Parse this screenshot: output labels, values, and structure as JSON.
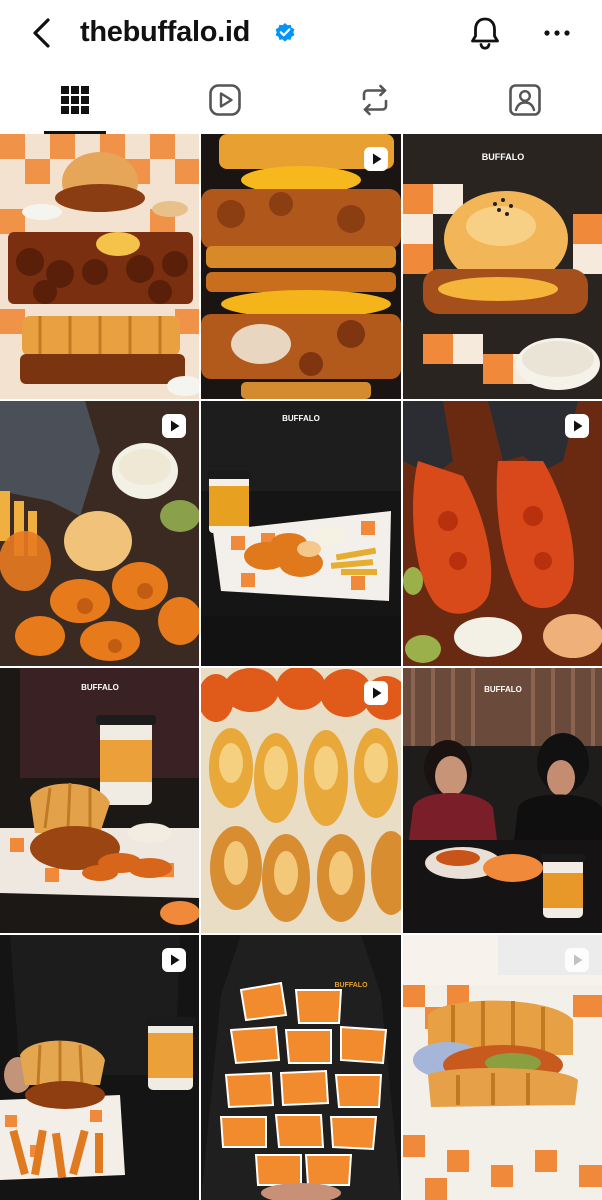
{
  "header": {
    "username": "thebuffalo.id",
    "back_icon": "chevron-left-icon",
    "verified_icon": "verified-badge-icon",
    "notifications_icon": "bell-icon",
    "more_icon": "more-horizontal-icon"
  },
  "tabs": [
    {
      "name": "posts",
      "icon": "grid-icon",
      "active": true
    },
    {
      "name": "reels",
      "icon": "reels-icon",
      "active": false
    },
    {
      "name": "reposts",
      "icon": "repost-icon",
      "active": false
    },
    {
      "name": "tagged",
      "icon": "tagged-user-icon",
      "active": false
    }
  ],
  "posts": [
    {
      "content": "chicken wings, burger and waffle on checkered paper",
      "is_reel": false
    },
    {
      "content": "stacked fried chicken and waffles",
      "is_reel": true
    },
    {
      "content": "fried chicken burger with dipping sauce",
      "is_reel": false
    },
    {
      "content": "hand dipping fried chicken into sauce",
      "is_reel": true
    },
    {
      "content": "cup and tray of wings with fries",
      "is_reel": false
    },
    {
      "content": "gloved hands holding hot fried chicken",
      "is_reel": true
    },
    {
      "content": "chicken and waffle with drink",
      "is_reel": false
    },
    {
      "content": "overhead chicken tenders spread",
      "is_reel": true
    },
    {
      "content": "two women laughing at table with food",
      "is_reel": false
    },
    {
      "content": "waffle chicken platter with fries and cup",
      "is_reel": true
    },
    {
      "content": "person holding stack of value bowls",
      "is_reel": false
    },
    {
      "content": "chicken waffle sandwich with slaw",
      "is_reel": true
    }
  ],
  "colors": {
    "accent_orange": "#f07c22",
    "verified_blue": "#0095f6"
  }
}
